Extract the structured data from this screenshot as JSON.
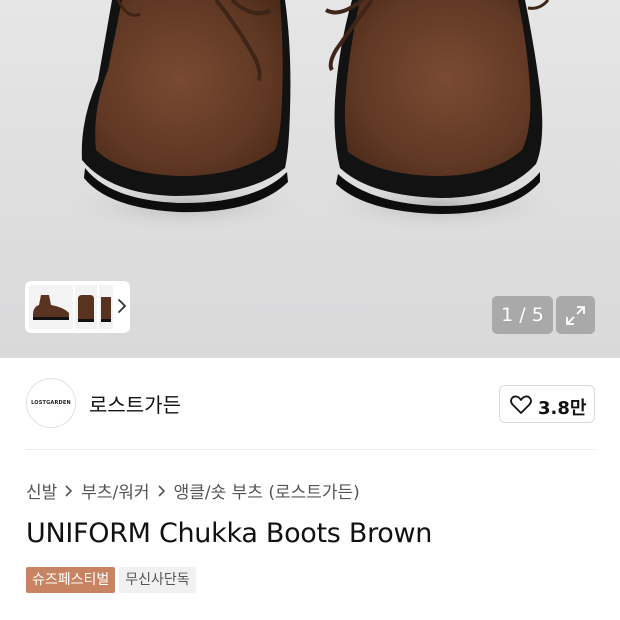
{
  "gallery": {
    "current": 1,
    "total": 5,
    "counter_label": "1 / 5",
    "icons": [
      "chevron-right-icon",
      "expand-icon"
    ]
  },
  "brand": {
    "logo_text": "LOSTGARDEN",
    "name": "로스트가든",
    "likes": "3.8만",
    "like_icon": "heart-outline-icon"
  },
  "breadcrumb": {
    "items": [
      "신발",
      "부츠/워커",
      "앵클/숏 부츠 (로스트가든)"
    ]
  },
  "product": {
    "title": "UNIFORM Chukka Boots Brown"
  },
  "badges": {
    "festival": "슈즈페스티벌",
    "exclusive": "무신사단독"
  },
  "colors": {
    "festival_badge": "#c88462",
    "exclusive_badge": "#f1f1f1",
    "boot_suede": "#6b3f29",
    "sole": "#141414"
  }
}
